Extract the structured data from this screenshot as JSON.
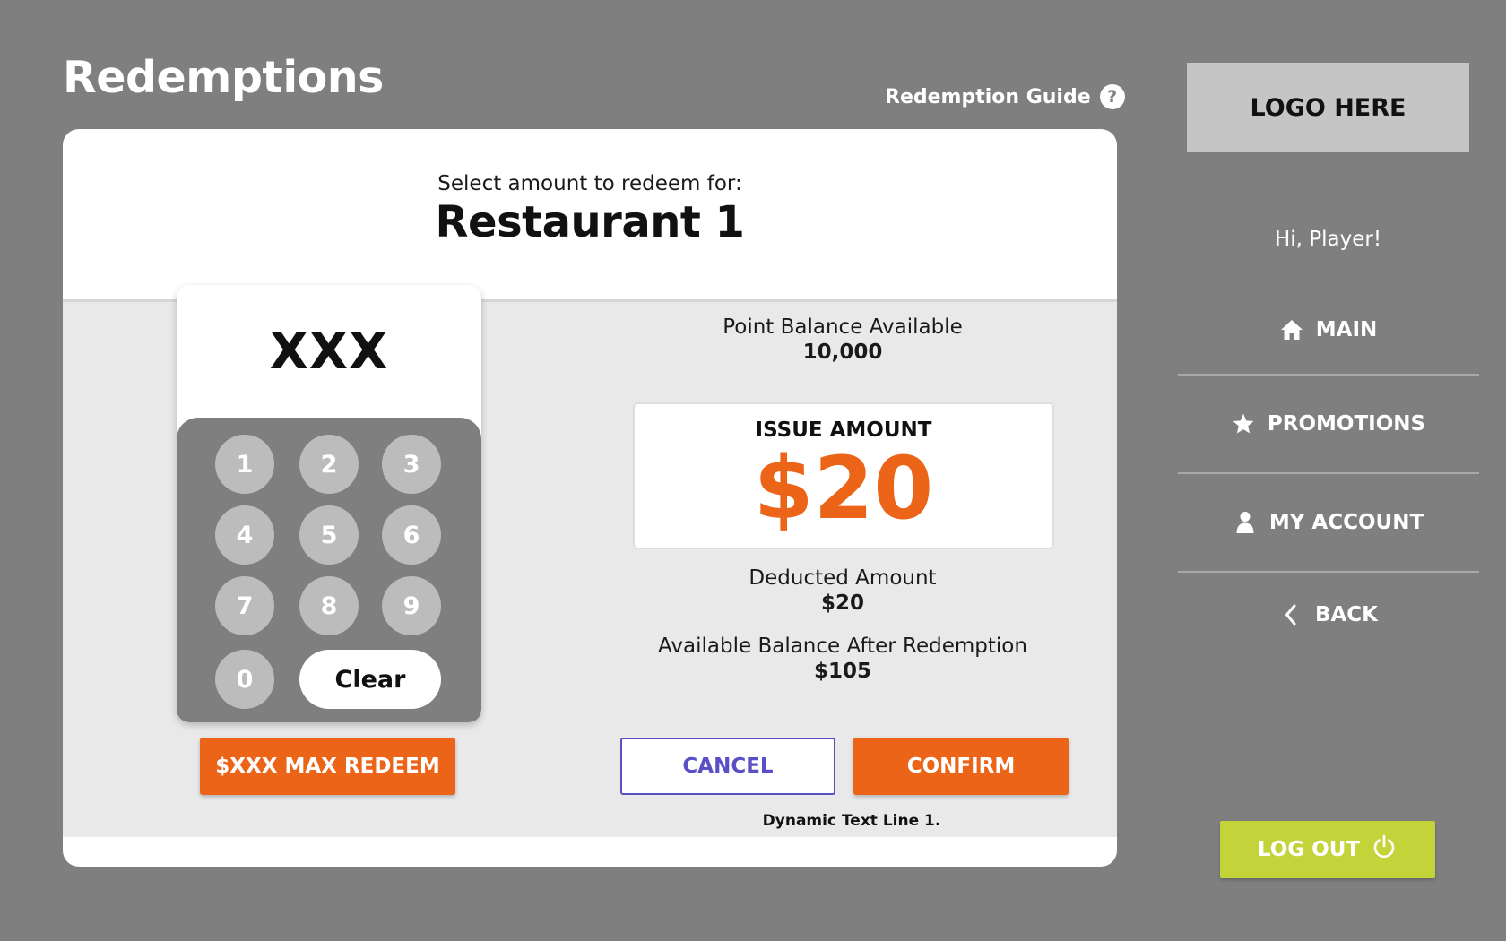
{
  "page": {
    "title": "Redemptions"
  },
  "guide": {
    "label": "Redemption Guide",
    "icon": "help-circle-icon"
  },
  "card": {
    "subtitle": "Select amount to redeem for:",
    "title": "Restaurant 1"
  },
  "keypad": {
    "display": "XXX",
    "keys": [
      "1",
      "2",
      "3",
      "4",
      "5",
      "6",
      "7",
      "8",
      "9",
      "0"
    ],
    "clear_label": "Clear"
  },
  "balance": {
    "label": "Point Balance Available",
    "value": "10,000"
  },
  "issue": {
    "label": "ISSUE AMOUNT",
    "amount": "$20"
  },
  "deducted": {
    "label": "Deducted Amount",
    "value": "$20"
  },
  "after": {
    "label": "Available Balance After Redemption",
    "value": "$105"
  },
  "buttons": {
    "max_redeem": "$XXX MAX REDEEM",
    "cancel": "CANCEL",
    "confirm": "CONFIRM"
  },
  "dynamic_text": "Dynamic Text Line 1.",
  "sidebar": {
    "logo": "LOGO HERE",
    "greeting": "Hi, Player!",
    "nav": [
      {
        "label": "MAIN",
        "icon": "home-icon"
      },
      {
        "label": "PROMOTIONS",
        "icon": "star-icon"
      },
      {
        "label": "MY ACCOUNT",
        "icon": "user-icon"
      },
      {
        "label": "BACK",
        "icon": "chevron-left-icon"
      }
    ],
    "logout": "LOG OUT"
  },
  "colors": {
    "background": "#7f7f7f",
    "accent_orange": "#ec6418",
    "cancel_blue": "#5b4fc6",
    "logout_green": "#c3d33a"
  }
}
